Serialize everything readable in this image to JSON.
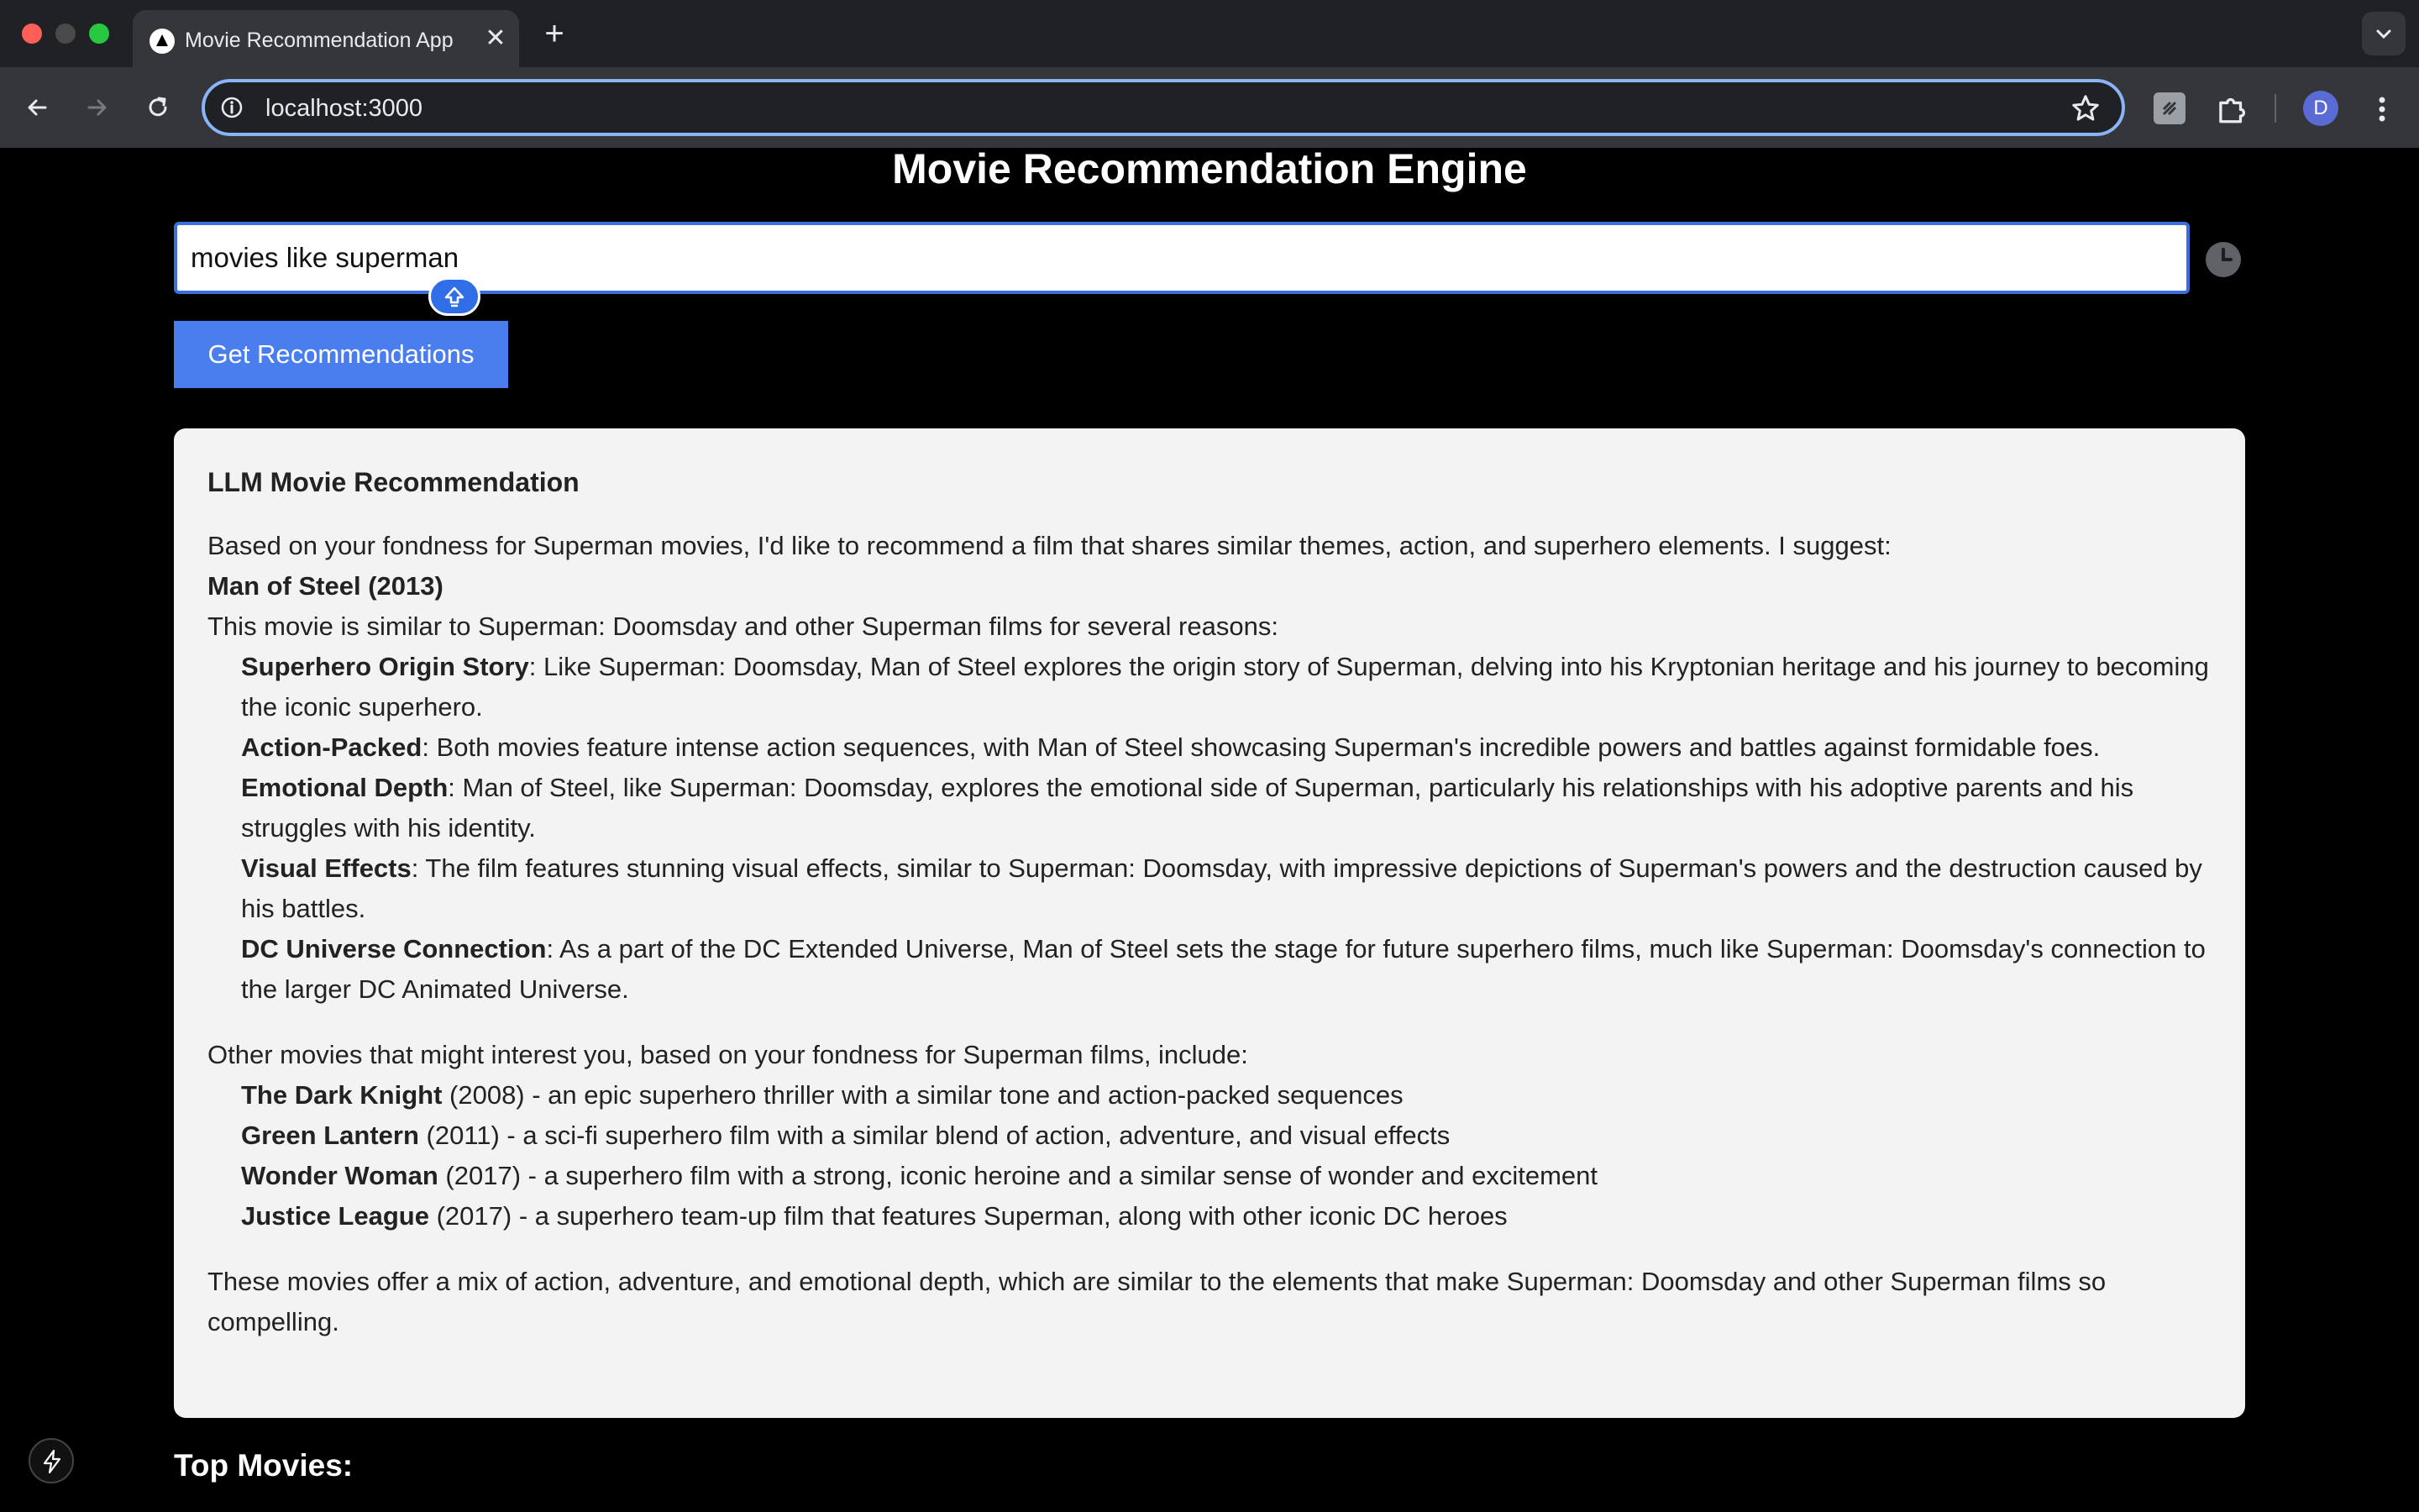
{
  "browser": {
    "tab_title": "Movie Recommendation App",
    "tab_close": "✕",
    "new_tab": "+",
    "url": "localhost:3000",
    "avatar_initial": "D"
  },
  "page": {
    "title": "Movie Recommendation Engine",
    "query_value": "movies like superman",
    "submit_label": "Get Recommendations"
  },
  "recommendation": {
    "heading": "LLM Movie Recommendation",
    "intro": "Based on your fondness for Superman movies, I'd like to recommend a film that shares similar themes, action, and superhero elements. I suggest:",
    "pick": "Man of Steel (2013)",
    "reasons_intro": "This movie is similar to Superman: Doomsday and other Superman films for several reasons:",
    "reasons": [
      {
        "title": "Superhero Origin Story",
        "text": ": Like Superman: Doomsday, Man of Steel explores the origin story of Superman, delving into his Kryptonian heritage and his journey to becoming the iconic superhero."
      },
      {
        "title": "Action-Packed",
        "text": ": Both movies feature intense action sequences, with Man of Steel showcasing Superman's incredible powers and battles against formidable foes."
      },
      {
        "title": "Emotional Depth",
        "text": ": Man of Steel, like Superman: Doomsday, explores the emotional side of Superman, particularly his relationships with his adoptive parents and his struggles with his identity."
      },
      {
        "title": "Visual Effects",
        "text": ": The film features stunning visual effects, similar to Superman: Doomsday, with impressive depictions of Superman's powers and the destruction caused by his battles."
      },
      {
        "title": "DC Universe Connection",
        "text": ": As a part of the DC Extended Universe, Man of Steel sets the stage for future superhero films, much like Superman: Doomsday's connection to the larger DC Animated Universe."
      }
    ],
    "others_intro": "Other movies that might interest you, based on your fondness for Superman films, include:",
    "others": [
      {
        "title": "The Dark Knight",
        "text": " (2008) - an epic superhero thriller with a similar tone and action-packed sequences"
      },
      {
        "title": "Green Lantern",
        "text": " (2011) - a sci-fi superhero film with a similar blend of action, adventure, and visual effects"
      },
      {
        "title": "Wonder Woman",
        "text": " (2017) - a superhero film with a strong, iconic heroine and a similar sense of wonder and excitement"
      },
      {
        "title": "Justice League",
        "text": " (2017) - a superhero team-up film that features Superman, along with other iconic DC heroes"
      }
    ],
    "conclusion": "These movies offer a mix of action, adventure, and emotional depth, which are similar to the elements that make Superman: Doomsday and other Superman films so compelling."
  },
  "top_movies": {
    "title": "Top Movies:"
  },
  "colors": {
    "accent": "#4a7ded",
    "focus_ring": "#3b6fe0",
    "card_bg": "#f3f3f3",
    "page_bg": "#000000"
  }
}
